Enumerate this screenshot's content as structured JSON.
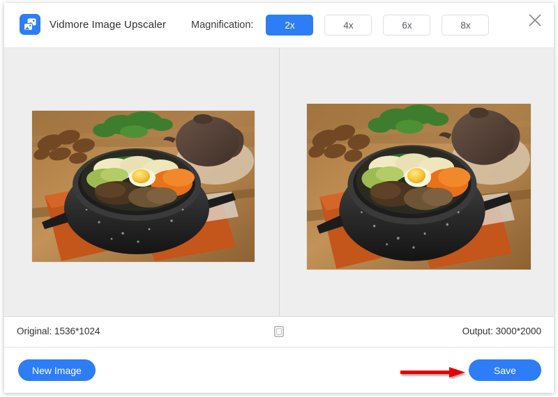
{
  "app": {
    "title": "Vidmore Image Upscaler",
    "logo_icon": "image-upscaler-logo-icon",
    "close_icon": "close-icon"
  },
  "header": {
    "magnification_label": "Magnification:",
    "options": [
      {
        "label": "2x",
        "active": true
      },
      {
        "label": "4x",
        "active": false
      },
      {
        "label": "6x",
        "active": false
      },
      {
        "label": "8x",
        "active": false
      }
    ]
  },
  "preview": {
    "left_pane": {
      "name": "original-image-pane",
      "image_description": "Korean bibimbap in a black stone bowl on an orange napkin with a dark clay teapot"
    },
    "right_pane": {
      "name": "upscaled-image-pane",
      "image_description": "Upscaled Korean bibimbap in a black stone bowl on an orange napkin with a dark clay teapot"
    }
  },
  "infobar": {
    "original": "Original: 1536*1024",
    "output": "Output: 3000*2000",
    "compare_icon": "compare-square-icon"
  },
  "footer": {
    "new_image_label": "New Image",
    "save_label": "Save",
    "annotation_icon": "red-arrow-annotation-icon"
  },
  "colors": {
    "accent_blue": "#2d7df6",
    "panel_grey": "#eeeeee",
    "annotation_red": "#e60000",
    "text_dark": "#303030"
  }
}
